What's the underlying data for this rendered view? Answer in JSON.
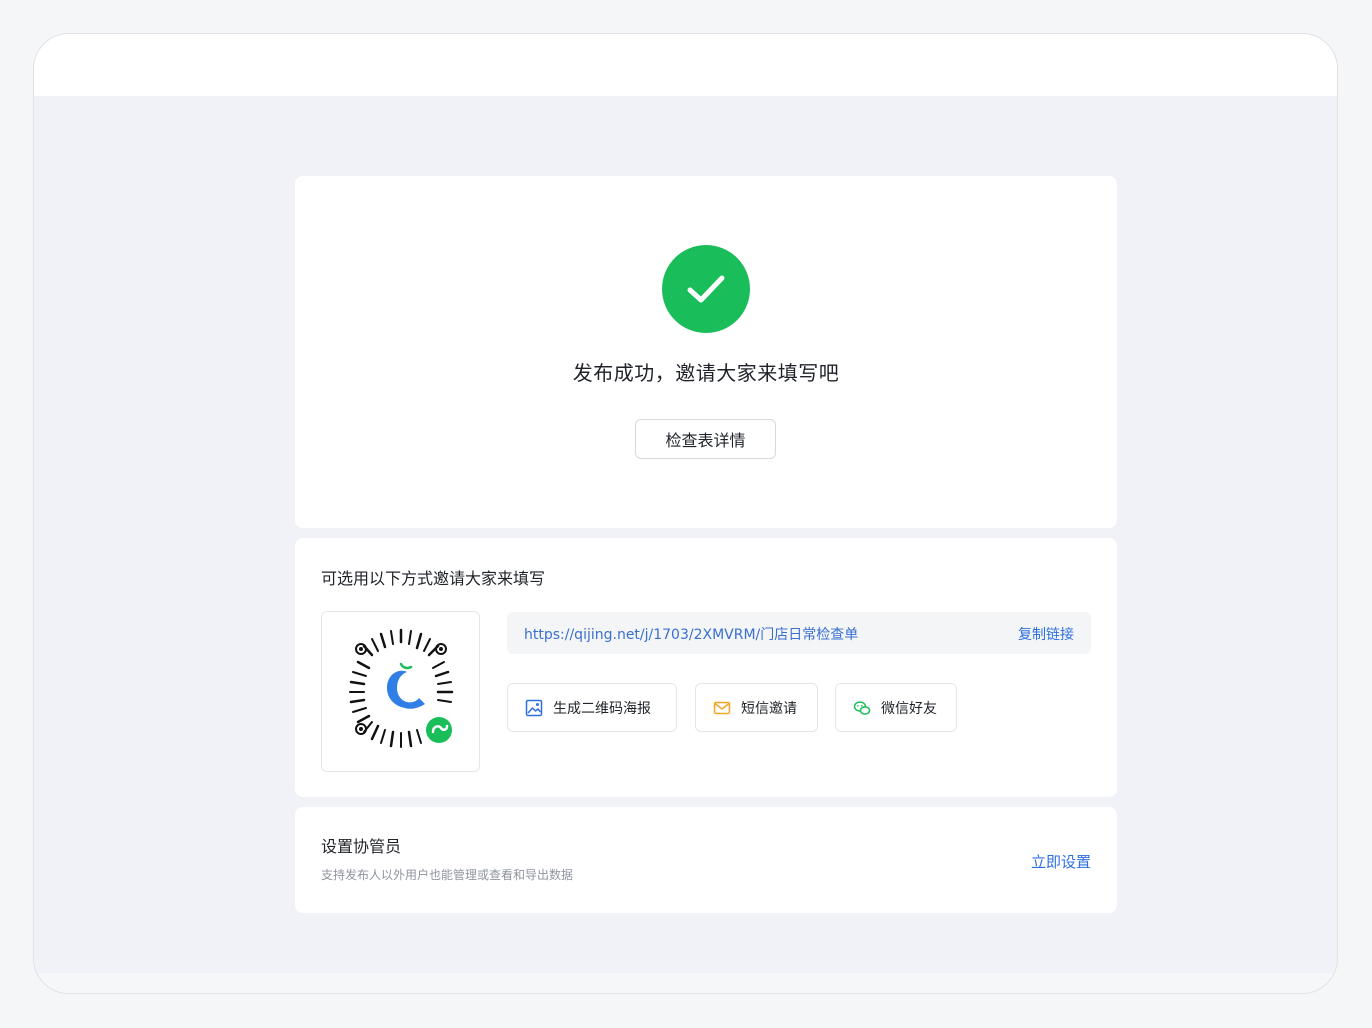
{
  "success": {
    "title": "发布成功，邀请大家来填写吧",
    "detail_button": "检查表详情",
    "icon": "check-circle-icon",
    "color": "#19be5a"
  },
  "invite": {
    "title": "可选用以下方式邀请大家来填写",
    "link": "https://qijing.net/j/1703/2XMVRM/门店日常检查单",
    "copy_label": "复制链接",
    "actions": [
      {
        "label": "生成二维码海报",
        "icon": "image-icon",
        "color": "#2f6fe4"
      },
      {
        "label": "短信邀请",
        "icon": "mail-icon",
        "color": "#f5a623"
      },
      {
        "label": "微信好友",
        "icon": "wechat-icon",
        "color": "#19be5a"
      }
    ]
  },
  "admin": {
    "title": "设置协管员",
    "subtitle": "支持发布人以外用户也能管理或查看和导出数据",
    "setup_label": "立即设置"
  },
  "colors": {
    "link": "#2f6fe4",
    "background": "#f1f2f7"
  }
}
